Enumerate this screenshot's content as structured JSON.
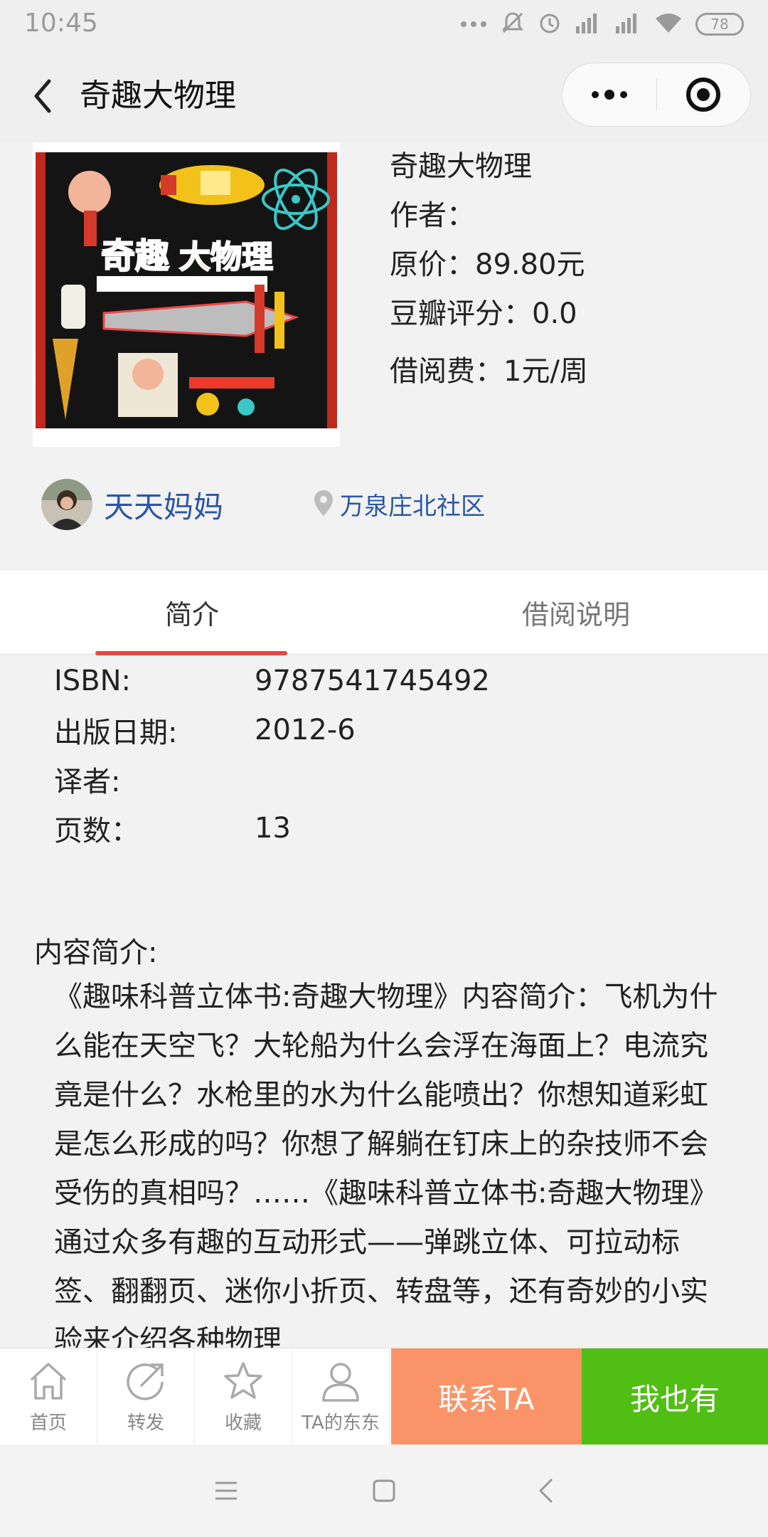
{
  "status_bar": {
    "time": "10:45",
    "battery": "78",
    "icons": [
      "dots-icon",
      "mute-icon",
      "alarm-icon",
      "signal-hd-icon",
      "signal-hd-icon",
      "wifi-icon",
      "battery-icon"
    ]
  },
  "nav": {
    "title": "奇趣大物理",
    "back_icon": "back-arrow-icon",
    "more_icon": "more-dots-icon",
    "close_icon": "target-icon"
  },
  "book": {
    "cover_alt": "book-cover",
    "title": "奇趣大物理",
    "author_label": "作者：",
    "price": "原价：89.80元",
    "rating": "豆瓣评分：0.0",
    "fee": "借阅费：1元/周"
  },
  "owner": {
    "name": "天天妈妈",
    "location": "万泉庄北社区"
  },
  "tabs": [
    {
      "label": "简介",
      "active": true
    },
    {
      "label": "借阅说明",
      "active": false
    }
  ],
  "meta": [
    {
      "label": "ISBN:",
      "value": "9787541745492"
    },
    {
      "label": "出版日期:",
      "value": "2012-6"
    },
    {
      "label": "译者:",
      "value": ""
    },
    {
      "label": "页数：",
      "value": "13"
    }
  ],
  "summary": {
    "title": "内容简介:",
    "text": "《趣味科普立体书:奇趣大物理》内容简介：飞机为什么能在天空飞？大轮船为什么会浮在海面上？电流究竟是什么？水枪里的水为什么能喷出？你想知道彩虹是怎么形成的吗？你想了解躺在钉床上的杂技师不会受伤的真相吗？……《趣味科普立体书:奇趣大物理》通过众多有趣的互动形式——弹跳立体、可拉动标签、翻翻页、迷你小折页、转盘等，还有奇妙的小实验来介绍各种物理"
  },
  "bottom_bar": {
    "home": "首页",
    "share": "转发",
    "favorite": "收藏",
    "ta_items": "TA的东东",
    "contact": "联系TA",
    "i_have": "我也有"
  },
  "colors": {
    "link": "#2b56a6",
    "tab_accent": "#e6473f",
    "contact_bg": "#fa9468",
    "have_bg": "#51be14"
  }
}
